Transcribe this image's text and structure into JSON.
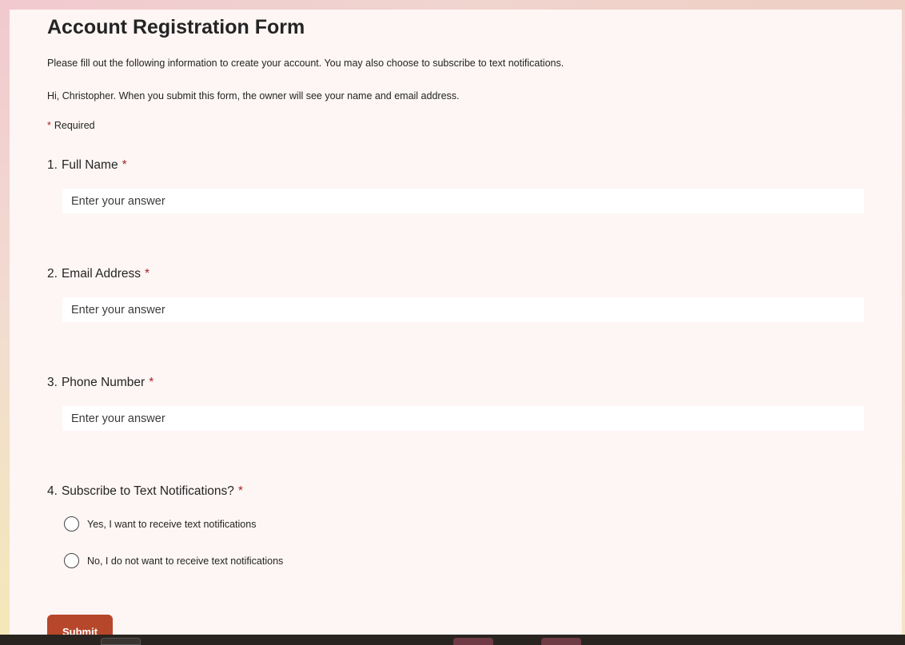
{
  "form": {
    "title": "Account Registration Form",
    "description": "Please fill out the following information to create your account. You may also choose to subscribe to text notifications.",
    "owner_notice": "Hi, Christopher. When you submit this form, the owner will see your name and email address.",
    "required_star": "*",
    "required_label": "Required"
  },
  "questions": [
    {
      "number": "1.",
      "label": "Full Name",
      "required_mark": "*",
      "placeholder": "Enter your answer"
    },
    {
      "number": "2.",
      "label": "Email Address",
      "required_mark": "*",
      "placeholder": "Enter your answer"
    },
    {
      "number": "3.",
      "label": "Phone Number",
      "required_mark": "*",
      "placeholder": "Enter your answer"
    },
    {
      "number": "4.",
      "label": "Subscribe to Text Notifications?",
      "required_mark": "*",
      "options": [
        "Yes, I want to receive text notifications",
        "No, I do not want to receive text notifications"
      ]
    }
  ],
  "submit_label": "Submit",
  "colors": {
    "accent": "#b7472a",
    "required": "#a4262c",
    "card_bg": "#fdf6f4"
  }
}
